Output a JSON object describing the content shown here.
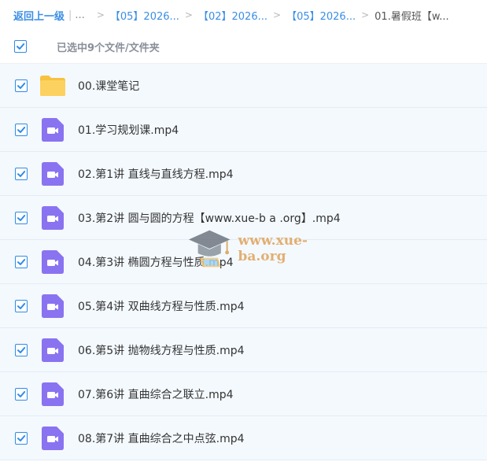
{
  "breadcrumb": {
    "back_label": "返回上一级",
    "separator": "|",
    "ellipsis": "...",
    "arrow": ">",
    "items": [
      "【05】2026...",
      "【02】2026...",
      "【05】2026..."
    ],
    "current": "01.暑假班【w..."
  },
  "selection": {
    "label": "已选中9个文件/文件夹",
    "all_checked": true
  },
  "files": [
    {
      "name": "00.课堂笔记",
      "type": "folder-icon",
      "checked": true
    },
    {
      "name": "01.学习规划课.mp4",
      "type": "video-icon",
      "checked": true
    },
    {
      "name": "02.第1讲 直线与直线方程.mp4",
      "type": "video-icon",
      "checked": true
    },
    {
      "name": "03.第2讲 圆与圆的方程【www.xue-b a .org】.mp4",
      "type": "video-icon",
      "checked": true
    },
    {
      "name": "04.第3讲 椭圆方程与性质.mp4",
      "type": "video-icon",
      "checked": true
    },
    {
      "name": "05.第4讲 双曲线方程与性质.mp4",
      "type": "video-icon",
      "checked": true
    },
    {
      "name": "06.第5讲 抛物线方程与性质.mp4",
      "type": "video-icon",
      "checked": true
    },
    {
      "name": "07.第6讲 直曲综合之联立.mp4",
      "type": "video-icon",
      "checked": true
    },
    {
      "name": "08.第7讲 直曲综合之中点弦.mp4",
      "type": "video-icon",
      "checked": true
    }
  ],
  "watermark": {
    "text": "www.xue-ba.org"
  },
  "colors": {
    "accent": "#2f8be8",
    "link": "#3a8ee6",
    "row_bg": "#f4f9fe",
    "folder": "#fcd15f",
    "video": "#8a73f0"
  }
}
